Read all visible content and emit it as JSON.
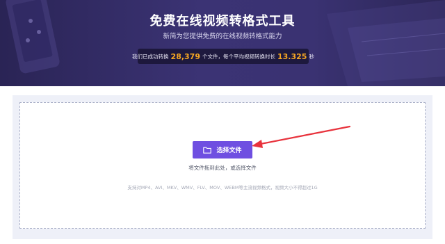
{
  "hero": {
    "title": "免费在线视频转格式工具",
    "subtitle": "新简为您提供免费的在线视频转格式能力",
    "stats": {
      "prefix": "我们已成功转换",
      "file_count": "28,379",
      "middle": "个文件，每个平均视频转换时长",
      "avg_seconds": "13.325",
      "suffix": "秒"
    }
  },
  "upload": {
    "button_label": "选择文件",
    "button_icon": "folder-icon",
    "drop_hint": "将文件拖到此处，或选择文件",
    "formats_hint": "支持对MP4、AVI、MKV、WMV、FLV、MOV、WEBM等主流视频格式，视频大小不得超过1G"
  },
  "colors": {
    "hero_bg": "#3a3272",
    "accent_number": "#f5a623",
    "button_bg": "#6f4fe1",
    "annotation_arrow": "#e8323c"
  }
}
